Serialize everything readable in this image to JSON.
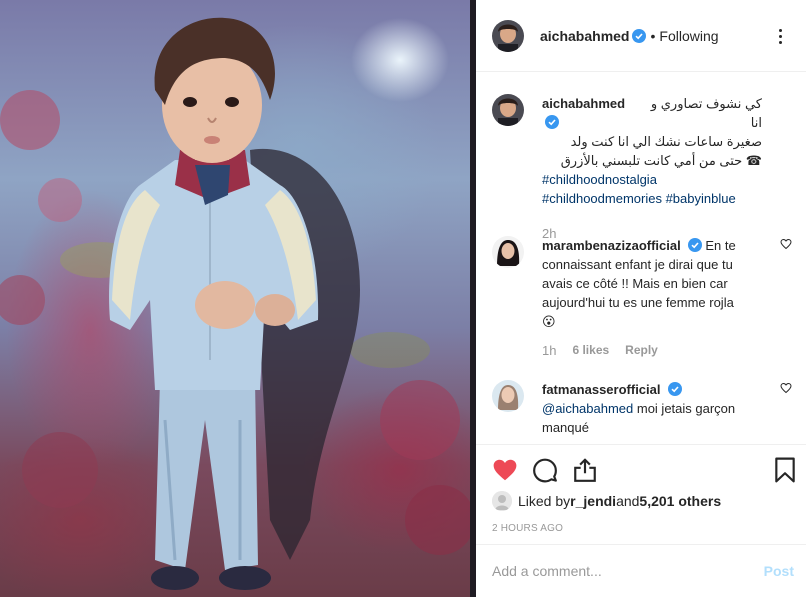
{
  "post": {
    "author": "aichabahmed",
    "follow_state": "Following",
    "caption_arabic_line1": "كي نشوف تصاوري و انا",
    "caption_arabic_line2": "صغيرة ساعات نشك الي انا كنت ولد",
    "caption_arabic_line3": "☎ حتى من أمي كانت تلبسني بالأزرق",
    "hashtags": [
      "#childhoodnostalgia",
      "#childhoodmemories",
      "#babyinblue"
    ],
    "caption_time": "2h"
  },
  "comments": [
    {
      "user": "marambenazizaofficial",
      "text_line1": "En te",
      "text_line2": "connaissant enfant je dirai que tu",
      "text_line3": "avais ce côté !! Mais en bien car",
      "text_line4": "aujourd'hui tu es une femme rojla",
      "text_line5": "😮",
      "time": "1h",
      "likes": "6 likes",
      "reply": "Reply"
    },
    {
      "user": "fatmanasserofficial",
      "mention": "@aichabahmed",
      "text_line1": " moi jetais garçon",
      "text_line2": "manqué"
    }
  ],
  "actions": {
    "liked_prefix": "Liked by ",
    "liked_user": "r_jendi",
    "liked_and": " and ",
    "liked_others": "5,201 others",
    "timestamp": "2 HOURS AGO"
  },
  "composer": {
    "placeholder": "Add a comment...",
    "post_label": "Post"
  },
  "colors": {
    "heart": "#ed4956",
    "verified": "#3897f0",
    "link": "#003569",
    "muted": "#999999"
  }
}
